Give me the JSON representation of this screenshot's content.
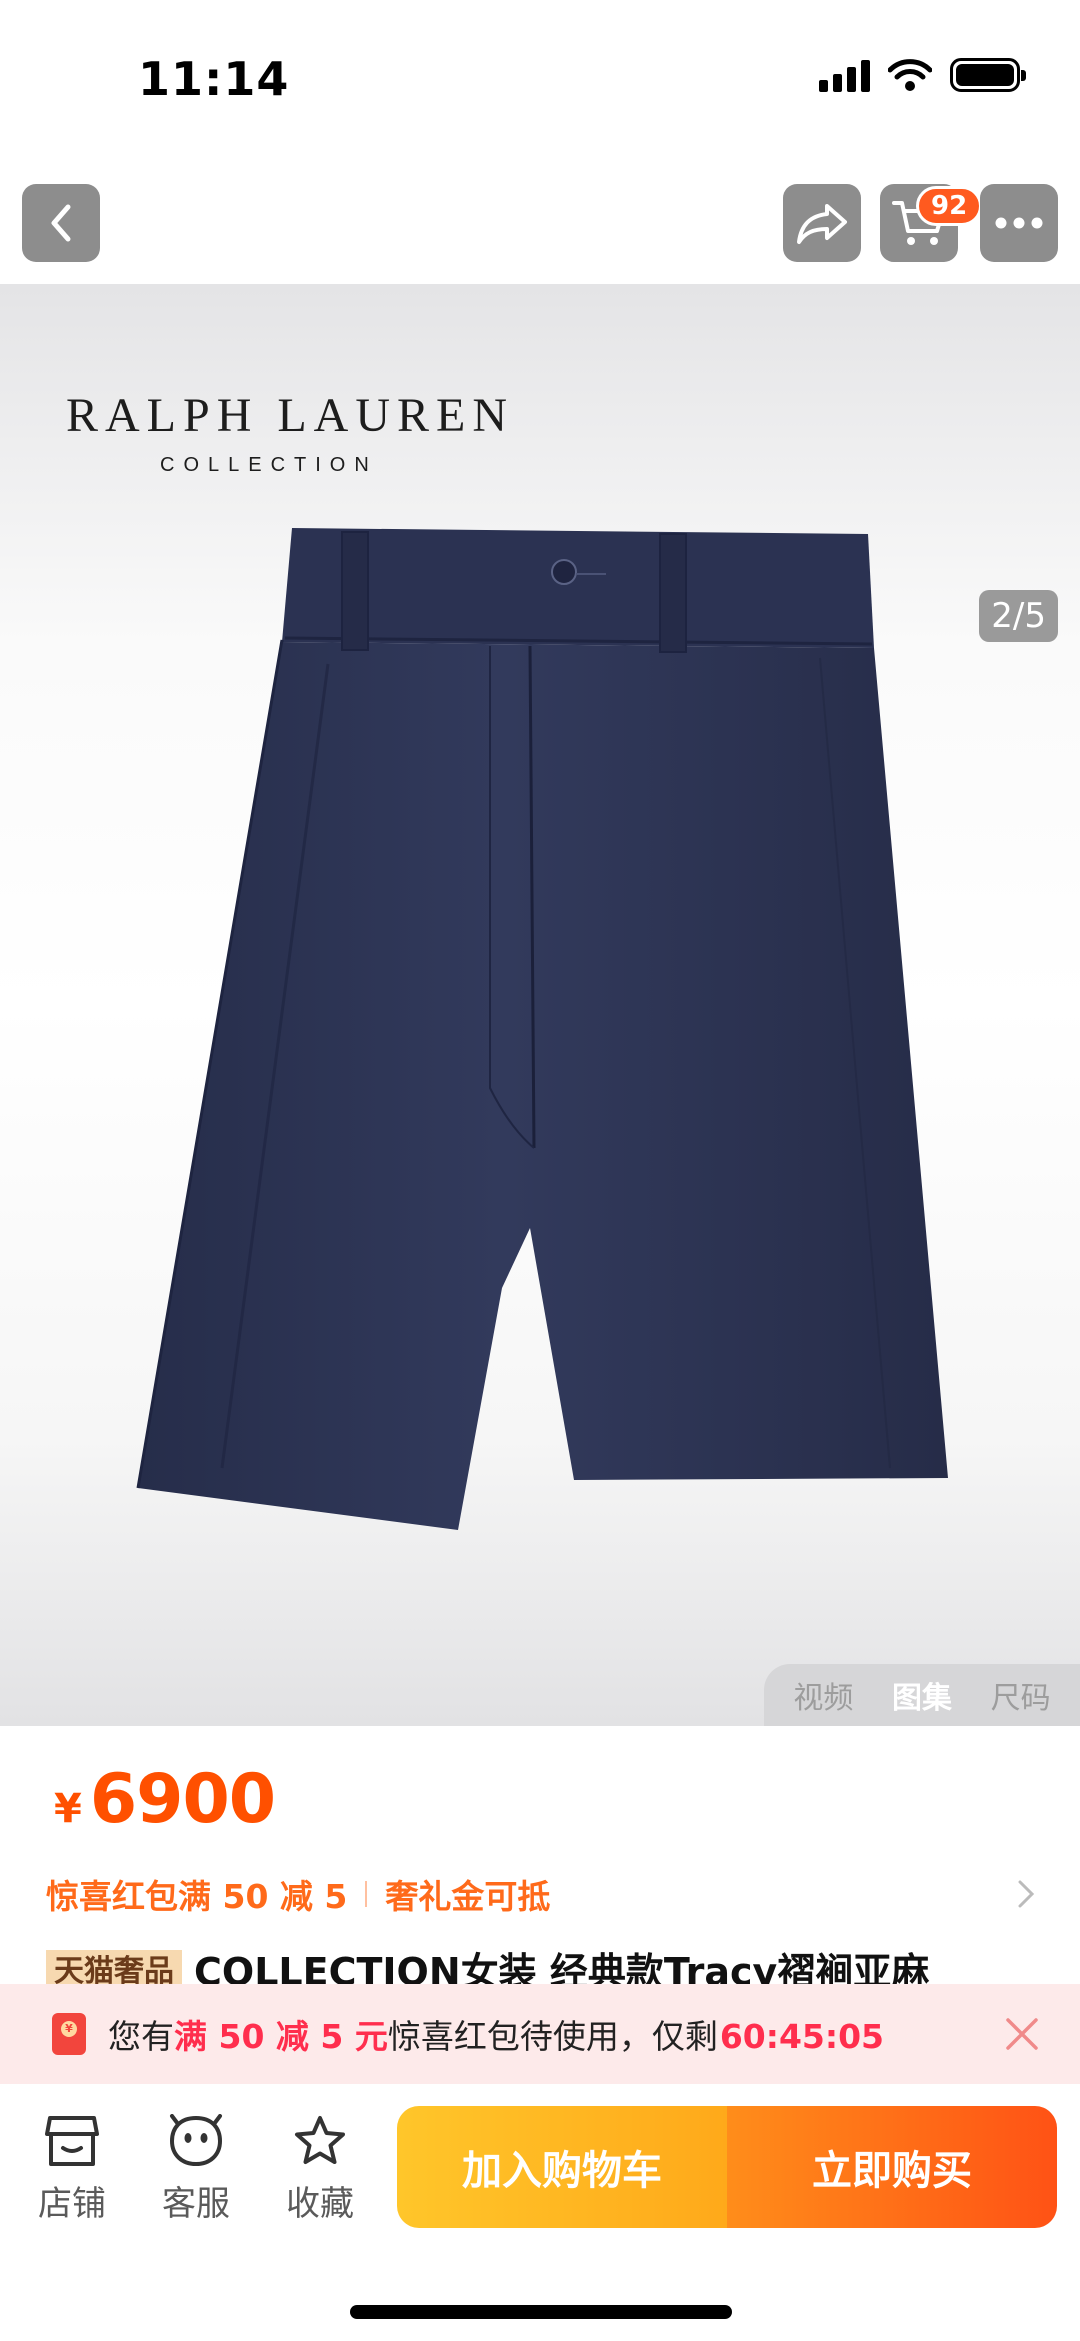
{
  "status_bar": {
    "time": "11:14"
  },
  "nav": {
    "cart_badge": "92"
  },
  "brand": {
    "name": "RALPH LAUREN",
    "sub": "COLLECTION"
  },
  "gallery": {
    "page_indicator": "2/5",
    "tabs": [
      {
        "label": "视频",
        "active": false
      },
      {
        "label": "图集",
        "active": true
      },
      {
        "label": "尺码",
        "active": false
      }
    ]
  },
  "price": {
    "symbol": "¥",
    "value": "6900"
  },
  "promo": {
    "coupon": "惊喜红包满 50 减 5",
    "gift": "奢礼金可抵"
  },
  "title": {
    "tag": "天猫奢品",
    "text": "COLLECTION女装 经典款Tracy褶裥亚麻"
  },
  "banner": {
    "prefix": "您有",
    "highlight": "满 50 减 5 元",
    "middle": "惊喜红包待使用，仅剩",
    "timer": "60:45:05"
  },
  "bottom_bar": {
    "store": "店铺",
    "service": "客服",
    "favorite": "收藏",
    "add_to_cart": "加入购物车",
    "buy_now": "立即购买"
  },
  "colors": {
    "price": "#ff5000",
    "banner_highlight": "#ff2e4d",
    "cart_button": "#ffb020",
    "buy_button": "#ff6a1a"
  }
}
